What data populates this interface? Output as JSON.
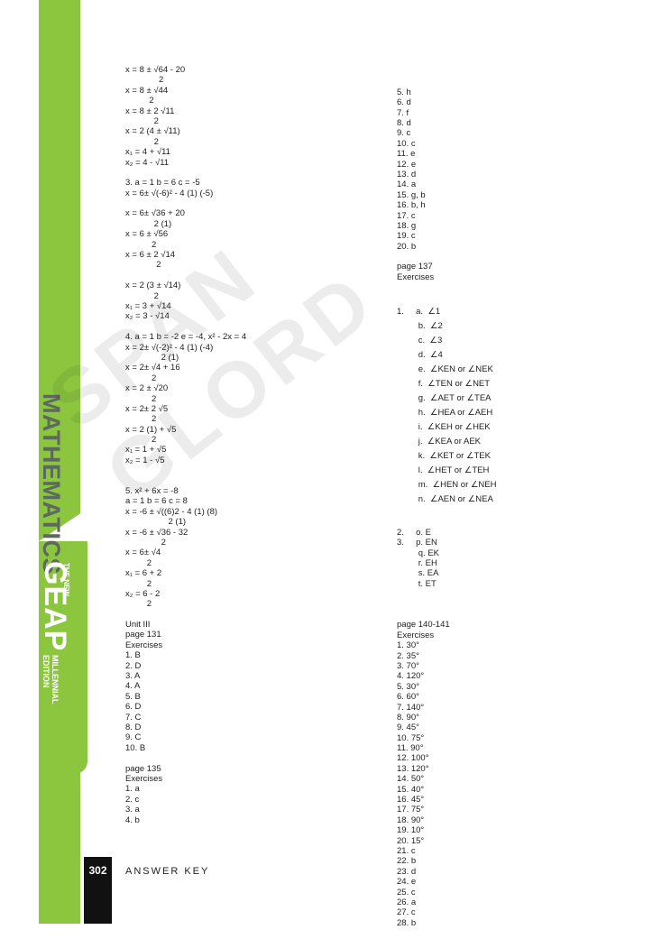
{
  "sidebar": {
    "subject": "MATHEMATICS",
    "series_top": "THE NEW",
    "series_brand": "GEAP",
    "edition_line1": "MILLENNIAL",
    "edition_line2": "EDITION"
  },
  "footer": {
    "page_number": "302",
    "section": "ANSWER KEY"
  },
  "watermark": "SPAN GLORD",
  "left_column": [
    "x = 8 ± √64 - 20",
    "              2",
    "x = 8 ± √44",
    "          2",
    "x = 8 ± 2 √11",
    "            2",
    "x = 2 (4 ± √11)",
    "            2",
    "x₁ = 4 + √11",
    "x₂ = 4 - √11",
    "",
    "3. a = 1 b = 6 c = -5",
    "x = 6± √(-6)² - 4 (1) (-5)",
    "",
    "x = 6± √36 + 20",
    "            2 (1)",
    "x = 6 ± √56",
    "           2",
    "x = 6 ± 2 √14",
    "             2",
    "",
    "x = 2 (3 ± √14)",
    "            2",
    "x₁ = 3 + √14",
    "x₂ = 3 - √14",
    "",
    "4. a = 1 b = -2 e = -4, x² - 2x = 4",
    "x = 2± √(-2)² - 4 (1) (-4)",
    "               2 (1)",
    "x = 2± √4 + 16",
    "           2",
    "x = 2 ± √20",
    "           2",
    "x = 2± 2 √5",
    "           2",
    "x = 2 (1) + √5",
    "           2",
    "x₁ = 1 + √5",
    "x₂ = 1 - √5",
    "",
    "",
    "5. x² + 6x = -8",
    "a = 1 b = 6 c = 8",
    "x = -6 ± √((6)2 - 4 (1) (8)",
    "                  2 (1)",
    "x = -6 ± √36 - 32",
    "               2",
    "x = 6± √4",
    "         2",
    "x₁ = 6 + 2",
    "         2",
    "x₂ = 6 - 2",
    "         2",
    "",
    "Unit III",
    "page 131",
    "Exercises",
    "1. B",
    "2. D",
    "3. A",
    "4. A",
    "5. B",
    "6. D",
    "7. C",
    "8. D",
    "9. C",
    "10. B",
    "",
    "page 135",
    "Exercises",
    "1. a",
    "2. c",
    "3. a",
    "4. b"
  ],
  "right_column_top": [
    "5. h",
    "6. d",
    "7. f",
    "8. d",
    "9. c",
    "10. c",
    "11. e",
    "12. e",
    "13. d",
    "14. a",
    "15. g, b",
    "16. b, h",
    "17. c",
    "18. g",
    "19. c",
    "20. b",
    "",
    "page 137",
    "Exercises"
  ],
  "angles": [
    "1.     a.  ∠1",
    "         b.  ∠2",
    "         c.  ∠3",
    "         d.  ∠4",
    "         e.  ∠KEN or ∠NEK",
    "         f.  ∠TEN or ∠NET",
    "         g.  ∠AET or ∠TEA",
    "         h.  ∠HEA or ∠AEH",
    "         i.  ∠KEH or ∠HEK",
    "         j.  ∠KEA or AEK",
    "         k.  ∠KET or ∠TEK",
    "         l.  ∠HET or ∠TEH",
    "         m.  ∠HEN or ∠NEH",
    "         n.  ∠AEN or ∠NEA"
  ],
  "rays": [
    "2.     o. E",
    "3.     p. EN",
    "         q. EK",
    "         r. EH",
    "         s. EA",
    "         t. ET"
  ],
  "right_column_bottom": [
    "",
    "page 140-141",
    "Exercises",
    "1. 30°",
    "2. 35°",
    "3. 70°",
    "4. 120°",
    "5. 30°",
    "6. 60°",
    "7. 140°",
    "8. 90°",
    "9. 45°",
    "10. 75°",
    "11. 90°",
    "12. 100°",
    "13. 120°",
    "14. 50°",
    "15. 40°",
    "16. 45°",
    "17. 75°",
    "18. 90°",
    "19. 10°",
    "20. 15°",
    "21. c",
    "22. b",
    "23. d",
    "24. e",
    "25. c",
    "26. a",
    "27. c",
    "28. b"
  ]
}
